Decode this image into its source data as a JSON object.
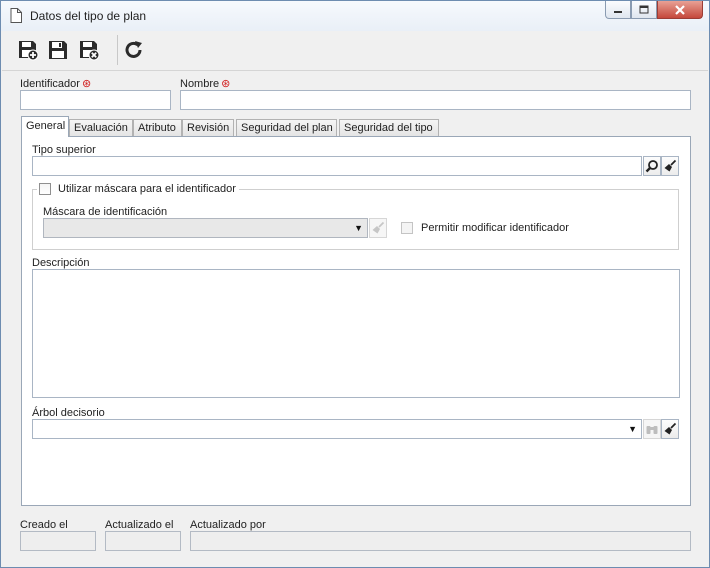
{
  "window": {
    "title": "Datos del tipo de plan"
  },
  "toolbar": {
    "buttons": [
      {
        "name": "save-new",
        "icon": "save-new-icon"
      },
      {
        "name": "save",
        "icon": "save-icon"
      },
      {
        "name": "save-close",
        "icon": "save-close-icon"
      },
      {
        "name": "refresh",
        "icon": "refresh-icon"
      }
    ]
  },
  "header": {
    "identifier_label": "Identificador",
    "identifier_value": "",
    "name_label": "Nombre",
    "name_value": "",
    "required_mark": "⊛"
  },
  "tabs": [
    "General",
    "Evaluación",
    "Atributo",
    "Revisión",
    "Seguridad del plan",
    "Seguridad del tipo"
  ],
  "general": {
    "parent_type_label": "Tipo superior",
    "parent_type_value": "",
    "use_mask_label": "Utilizar máscara para el identificador",
    "use_mask_checked": false,
    "mask_label": "Máscara de identificación",
    "mask_value": "",
    "allow_modify_label": "Permitir modificar identificador",
    "allow_modify_checked": false,
    "description_label": "Descripción",
    "description_value": "",
    "decision_tree_label": "Árbol decisorio",
    "decision_tree_value": ""
  },
  "footer": {
    "created_label": "Creado el",
    "created_value": "",
    "updated_label": "Actualizado el",
    "updated_value": "",
    "updated_by_label": "Actualizado por",
    "updated_by_value": ""
  },
  "colors": {
    "required": "#d21e1e",
    "border": "#a9b5c4",
    "panel_border": "#9aa7b7",
    "close_button": "#c5483b"
  }
}
